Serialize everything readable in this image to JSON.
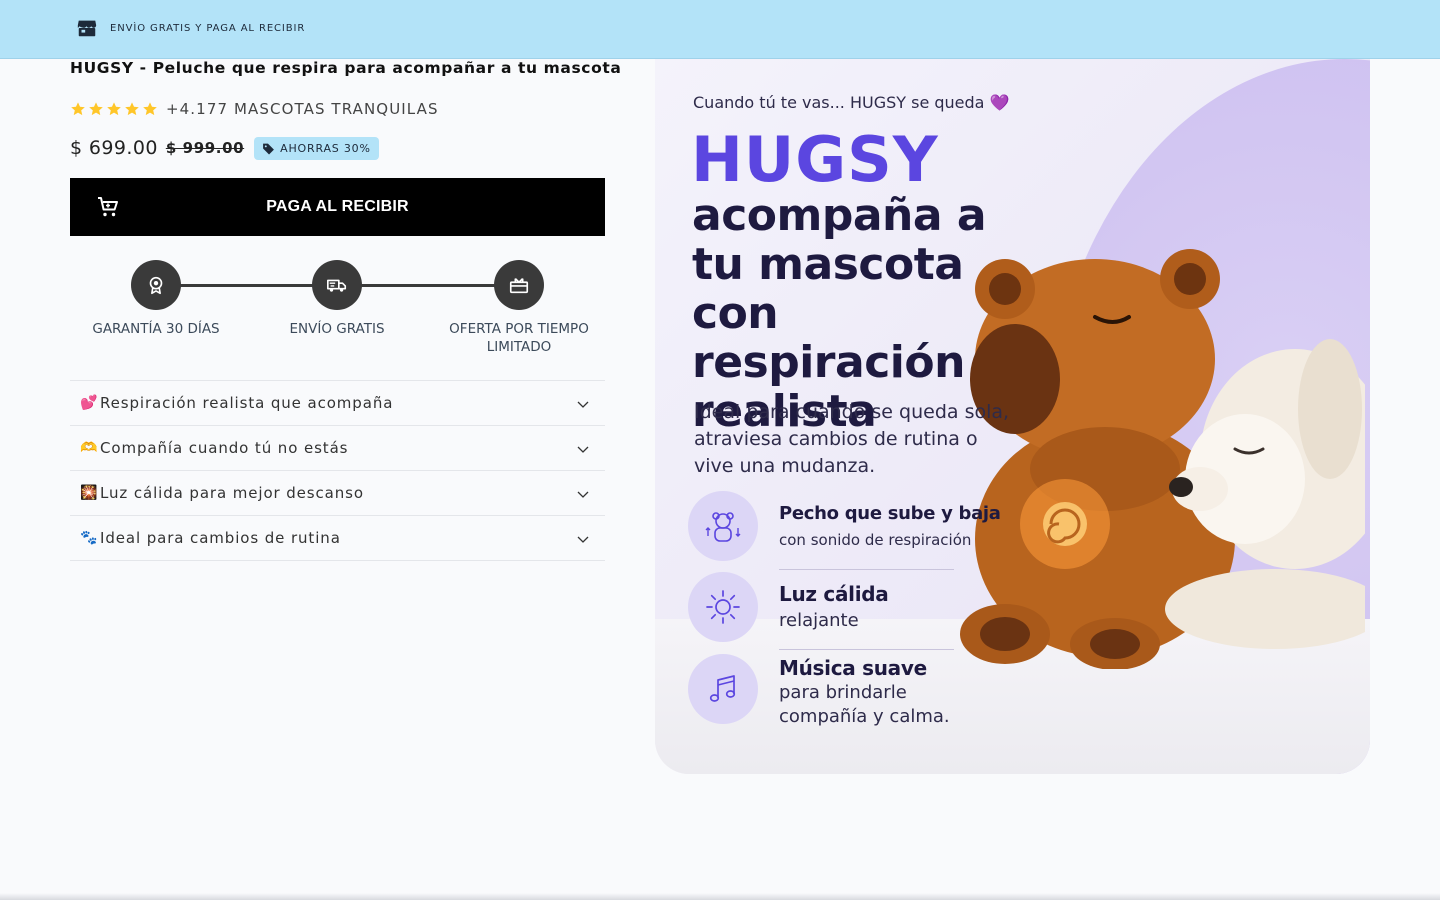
{
  "announcement": {
    "icon": "store-icon",
    "text": "ENVÌO GRATIS Y PAGA AL RECIBIR"
  },
  "product": {
    "title": "HUGSY - Peluche que respira para acompañar a tu mascota",
    "rating": {
      "stars": 5,
      "star_color": "#ffc629",
      "text": "+4.177 MASCOTAS TRANQUILAS"
    },
    "price": "$ 699.00",
    "compare_price": "$ 999.00",
    "save_badge": "AHORRAS 30%"
  },
  "cta": {
    "label": "PAGA AL RECIBIR",
    "icon": "cart-icon"
  },
  "steps": [
    {
      "icon": "award-icon",
      "label": "GARANTÍA 30 DÍAS"
    },
    {
      "icon": "truck-icon",
      "label": "ENVÍO GRATIS"
    },
    {
      "icon": "gift-icon",
      "label": "OFERTA POR TIEMPO LIMITADO"
    }
  ],
  "accordion": [
    {
      "emoji": "💕",
      "label": "Respiración realista que acompaña"
    },
    {
      "emoji": "🫶",
      "label": "Compañía cuando tú no estás"
    },
    {
      "emoji": "🎇",
      "label": "Luz cálida para mejor descanso"
    },
    {
      "emoji": "🐾",
      "label": " Ideal para cambios de rutina"
    }
  ],
  "hero": {
    "tagline": "Cuando tú te vas... HUGSY se queda 💜",
    "brand": "HUGSY",
    "headline": "acompaña a tu mascota con respiración realista",
    "subtitle": "Ideal para cuando se queda sola, atraviesa cambios de rutina o vive una mudanza.",
    "features": [
      {
        "icon": "bear-breathing-icon",
        "title": "Pecho que sube y baja",
        "desc": "con sonido de respiración"
      },
      {
        "icon": "sun-icon",
        "title": "Luz cálida",
        "desc": "relajante"
      },
      {
        "icon": "music-note-icon",
        "title": "Música suave",
        "desc": "para brindarle",
        "desc2": "compañía y calma."
      }
    ],
    "brand_color": "#5b46e0"
  },
  "colors": {
    "announcement_bg": "#b3e3f8",
    "cta_bg": "#000000",
    "step_circle": "#3a3a3a"
  }
}
